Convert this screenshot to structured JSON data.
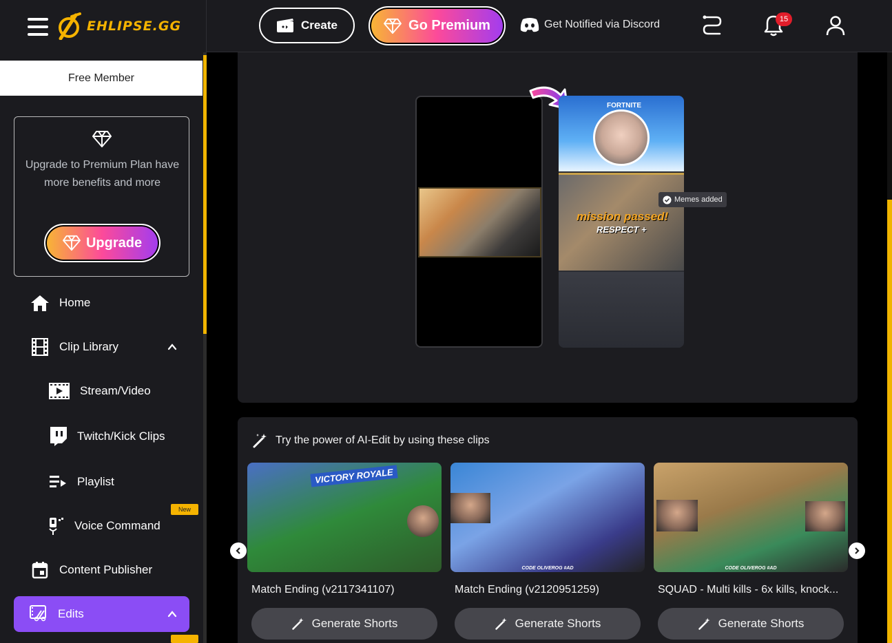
{
  "brand": {
    "logo_text": "EHLIPSE.GG"
  },
  "sidebar": {
    "member_status": "Free Member",
    "upgrade_card": {
      "message": "Upgrade to Premium Plan have more benefits and more",
      "button_label": "Upgrade"
    },
    "items": [
      {
        "label": "Home",
        "icon": "home-icon"
      },
      {
        "label": "Clip Library",
        "icon": "film-icon",
        "expanded": true
      },
      {
        "label": "Stream/Video",
        "icon": "video-icon"
      },
      {
        "label": "Twitch/Kick Clips",
        "icon": "twitch-icon"
      },
      {
        "label": "Playlist",
        "icon": "playlist-icon"
      },
      {
        "label": "Voice Command",
        "icon": "voice-command-icon",
        "badge": "New"
      },
      {
        "label": "Content Publisher",
        "icon": "calendar-icon"
      },
      {
        "label": "Edits",
        "icon": "edits-icon",
        "active": true
      }
    ],
    "accent_color": "#8b4df5",
    "highlight_color": "#f5b300"
  },
  "topbar": {
    "create_label": "Create",
    "premium_label": "Go Premium",
    "discord_label": "Get Notified via Discord",
    "notification_count": "15"
  },
  "hero": {
    "memes_tag": "Memes added",
    "phone_text": {
      "game": "FORTNITE",
      "mission": "mission passed!",
      "respect": "RESPECT +"
    }
  },
  "ai_edit": {
    "title": "Try the power of AI-Edit by using these clips",
    "clips": [
      {
        "title": "Match Ending (v2117341107)",
        "button": "Generate Shorts",
        "overlay": "VICTORY ROYALE"
      },
      {
        "title": "Match Ending (v2120951259)",
        "button": "Generate Shorts",
        "overlay": "CODE OLIVEROG #AD"
      },
      {
        "title": "SQUAD - Multi kills - 6x kills, knock...",
        "button": "Generate Shorts",
        "overlay": "CODE OLIVEROG #AD"
      }
    ]
  }
}
